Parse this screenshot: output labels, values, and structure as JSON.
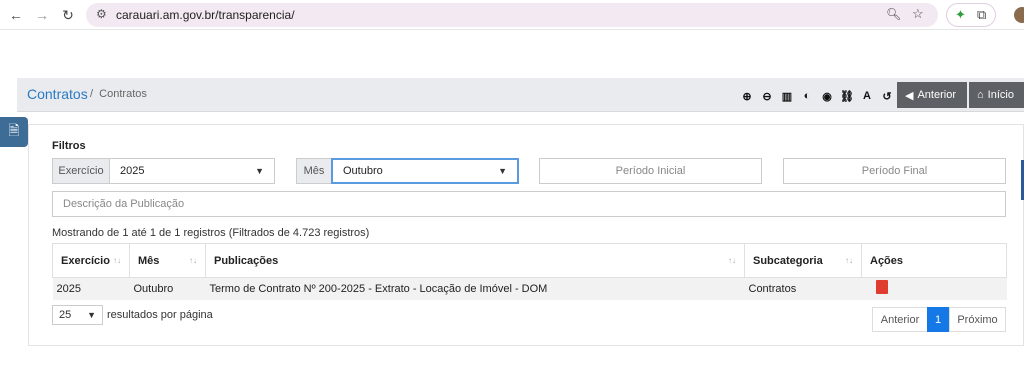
{
  "browser": {
    "url": "carauari.am.gov.br/transparencia/"
  },
  "header": {
    "title": "Contratos",
    "breadcrumb_current": "Contratos",
    "btn_prev": "Anterior",
    "btn_home": "Início"
  },
  "filters": {
    "section_label": "Filtros",
    "exercicio_label": "Exercício",
    "exercicio_value": "2025",
    "mes_label": "Mês",
    "mes_value": "Outubro",
    "periodo_inicial_placeholder": "Período Inicial",
    "periodo_final_placeholder": "Período Final",
    "descricao_placeholder": "Descrição da Publicação"
  },
  "results_info": "Mostrando de 1 até 1 de 1 registros (Filtrados de 4.723 registros)",
  "table": {
    "columns": [
      "Exercício",
      "Mês",
      "Publicações",
      "Subcategoria",
      "Ações"
    ],
    "rows": [
      [
        "2025",
        "Outubro",
        "Termo de Contrato Nº 200-2025 - Extrato - Locação de Imóvel - DOM",
        "Contratos"
      ]
    ]
  },
  "pagination": {
    "page_size": "25",
    "page_size_label": "resultados por página",
    "prev": "Anterior",
    "current": "1",
    "next": "Próximo"
  },
  "colors": {
    "accent": "#1479e6",
    "header_bg": "#e9ebee",
    "dark_button": "#5d6165",
    "pdf_icon": "#e03b2f"
  }
}
